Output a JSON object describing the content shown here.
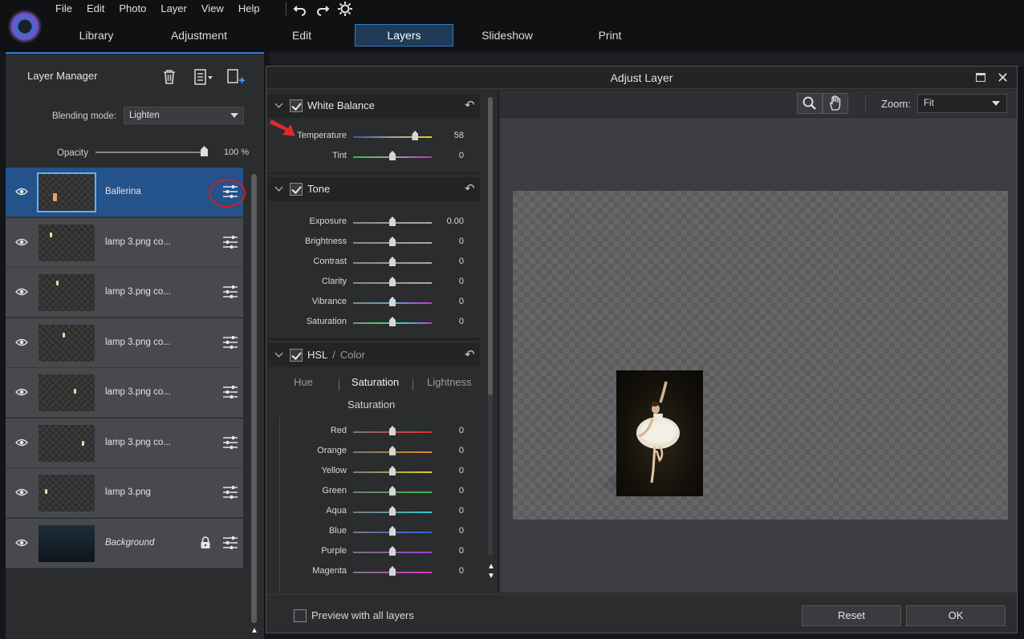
{
  "menu": [
    "File",
    "Edit",
    "Photo",
    "Layer",
    "View",
    "Help"
  ],
  "quick_actions": {
    "undo_icon": "undo-icon",
    "redo_icon": "redo-icon",
    "settings_icon": "gear-icon"
  },
  "main_tabs": [
    {
      "label": "Library",
      "active": false
    },
    {
      "label": "Adjustment",
      "active": false
    },
    {
      "label": "Edit",
      "active": false
    },
    {
      "label": "Layers",
      "active": true
    },
    {
      "label": "Slideshow",
      "active": false
    },
    {
      "label": "Print",
      "active": false
    }
  ],
  "layer_manager": {
    "title": "Layer Manager",
    "blending_label": "Blending mode:",
    "blending_value": "Lighten",
    "opacity_label": "Opacity",
    "opacity_value": "100 %",
    "opacity_fraction": 1.0,
    "layers": [
      {
        "name": "Ballerina",
        "selected": true,
        "italic": false,
        "locked": false
      },
      {
        "name": "lamp 3.png co...",
        "selected": false,
        "italic": false,
        "locked": false
      },
      {
        "name": "lamp 3.png co...",
        "selected": false,
        "italic": false,
        "locked": false
      },
      {
        "name": "lamp 3.png co...",
        "selected": false,
        "italic": false,
        "locked": false
      },
      {
        "name": "lamp 3.png co...",
        "selected": false,
        "italic": false,
        "locked": false
      },
      {
        "name": "lamp 3.png co...",
        "selected": false,
        "italic": false,
        "locked": false
      },
      {
        "name": "lamp 3.png",
        "selected": false,
        "italic": false,
        "locked": false
      },
      {
        "name": "Background",
        "selected": false,
        "italic": true,
        "locked": true
      }
    ]
  },
  "dialog": {
    "title": "Adjust Layer",
    "white_balance": {
      "title": "White Balance",
      "sliders": [
        {
          "label": "Temperature",
          "value": "58",
          "position": 0.79,
          "track": "linear-gradient(90deg,#3a52c8,#9aa0a0,#e0d030)"
        },
        {
          "label": "Tint",
          "value": "0",
          "position": 0.5,
          "track": "linear-gradient(90deg,#30c040,#a0a0a0,#c030c8)"
        }
      ]
    },
    "tone": {
      "title": "Tone",
      "sliders": [
        {
          "label": "Exposure",
          "value": "0.00",
          "position": 0.5,
          "track": "linear-gradient(90deg,#888,#aaa)"
        },
        {
          "label": "Brightness",
          "value": "0",
          "position": 0.5,
          "track": "linear-gradient(90deg,#888,#aaa)"
        },
        {
          "label": "Contrast",
          "value": "0",
          "position": 0.5,
          "track": "linear-gradient(90deg,#888,#aaa)"
        },
        {
          "label": "Clarity",
          "value": "0",
          "position": 0.5,
          "track": "linear-gradient(90deg,#888,#aaa)"
        },
        {
          "label": "Vibrance",
          "value": "0",
          "position": 0.5,
          "track": "linear-gradient(90deg,#888,#5ab,#c3c)"
        },
        {
          "label": "Saturation",
          "value": "0",
          "position": 0.5,
          "track": "linear-gradient(90deg,#888,#5c5,#3cc,#c3c)"
        }
      ]
    },
    "hsl": {
      "title": "HSL",
      "title_sep": "/",
      "title_suffix": "Color",
      "tabs": [
        "Hue",
        "Saturation",
        "Lightness"
      ],
      "active_tab": "Saturation",
      "sub_title": "Saturation",
      "sliders": [
        {
          "label": "Red",
          "value": "0",
          "position": 0.5,
          "track": "linear-gradient(90deg,#777,#e03030)"
        },
        {
          "label": "Orange",
          "value": "0",
          "position": 0.5,
          "track": "linear-gradient(90deg,#777,#e08a20)"
        },
        {
          "label": "Yellow",
          "value": "0",
          "position": 0.5,
          "track": "linear-gradient(90deg,#777,#e0d020)"
        },
        {
          "label": "Green",
          "value": "0",
          "position": 0.5,
          "track": "linear-gradient(90deg,#777,#30c040)"
        },
        {
          "label": "Aqua",
          "value": "0",
          "position": 0.5,
          "track": "linear-gradient(90deg,#777,#30c8d0)"
        },
        {
          "label": "Blue",
          "value": "0",
          "position": 0.5,
          "track": "linear-gradient(90deg,#777,#3060e0)"
        },
        {
          "label": "Purple",
          "value": "0",
          "position": 0.5,
          "track": "linear-gradient(90deg,#777,#a040d8)"
        },
        {
          "label": "Magenta",
          "value": "0",
          "position": 0.5,
          "track": "linear-gradient(90deg,#777,#e030c8)"
        }
      ]
    },
    "zoom_label": "Zoom:",
    "zoom_value": "Fit",
    "preview_all_label": "Preview with all layers",
    "reset_label": "Reset",
    "ok_label": "OK"
  },
  "colors": {
    "accent": "#2f7cc8",
    "selected_layer": "#24528a",
    "annotation_red": "#d02020"
  }
}
